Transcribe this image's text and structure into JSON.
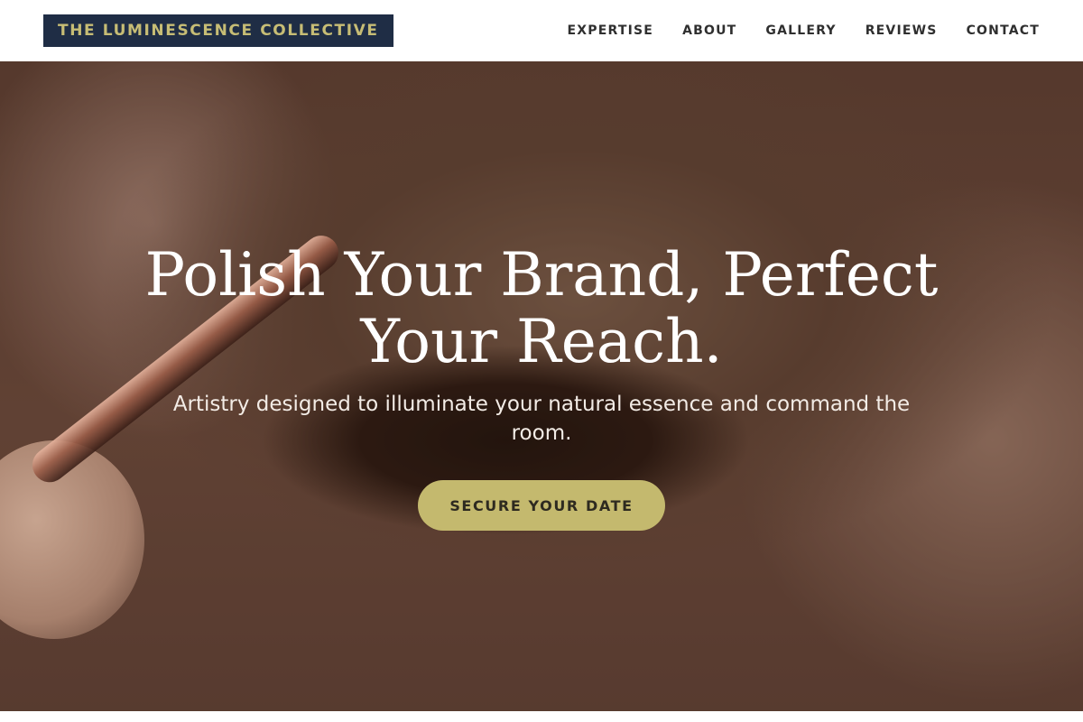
{
  "brand": {
    "name": "THE LUMINESCENCE COLLECTIVE"
  },
  "nav": {
    "items": [
      {
        "label": "EXPERTISE"
      },
      {
        "label": "ABOUT"
      },
      {
        "label": "GALLERY"
      },
      {
        "label": "REVIEWS"
      },
      {
        "label": "CONTACT"
      }
    ]
  },
  "hero": {
    "headline": "Polish Your Brand, Perfect Your Reach.",
    "subhead": "Artistry designed to illuminate your natural essence and command the room.",
    "cta_label": "SECURE YOUR DATE"
  },
  "colors": {
    "logo_bg": "#1f2d45",
    "logo_text": "#c7bd75",
    "cta_bg": "#c4b96e",
    "nav_text": "#2f2f2f"
  }
}
